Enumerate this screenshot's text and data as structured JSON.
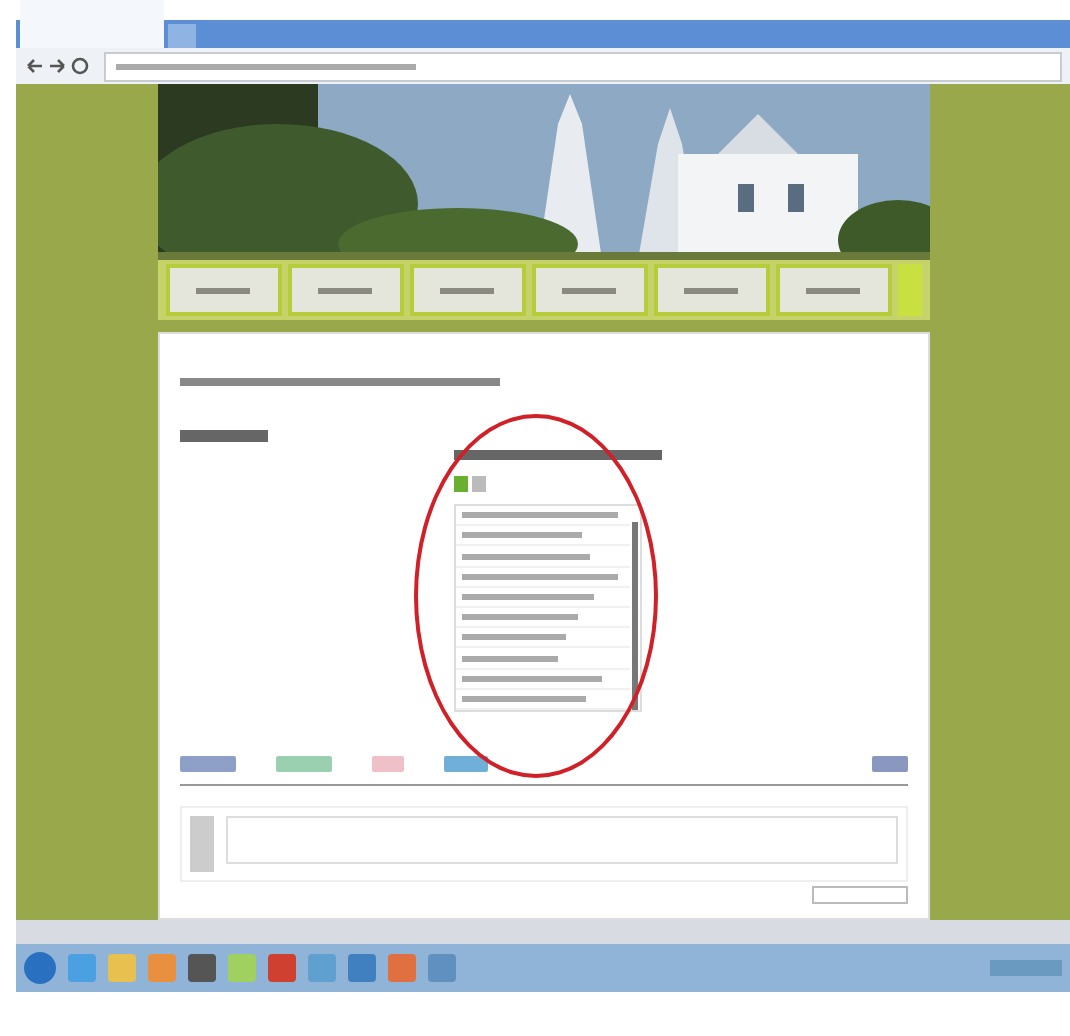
{
  "browser": {
    "tabs": [
      {
        "kind": "page",
        "selected": true
      },
      {
        "kind": "new",
        "selected": false
      }
    ]
  },
  "nav": {
    "items": [
      {
        "selected": false
      },
      {
        "selected": false
      },
      {
        "selected": false
      },
      {
        "selected": false
      },
      {
        "selected": false
      },
      {
        "selected": false
      }
    ]
  },
  "widget": {
    "rows": [
      {
        "kind": "link"
      },
      {
        "kind": "link"
      },
      {
        "kind": "link"
      },
      {
        "kind": "link"
      },
      {
        "kind": "link"
      },
      {
        "kind": "link"
      },
      {
        "kind": "link"
      },
      {
        "kind": "link"
      },
      {
        "kind": "link"
      },
      {
        "kind": "link"
      }
    ]
  },
  "annotation": {
    "kind": "ellipse"
  }
}
